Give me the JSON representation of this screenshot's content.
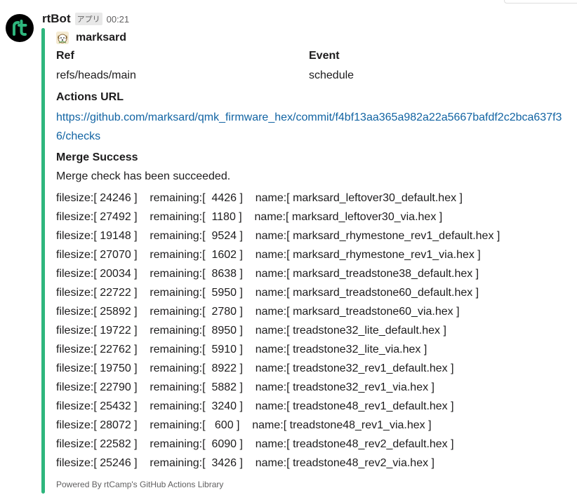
{
  "message": {
    "bot_name": "rtBot",
    "app_badge": "アプリ",
    "timestamp": "00:21",
    "avatar_icon": "rt-logo-icon"
  },
  "attachment": {
    "bar_color": "#2eb67d",
    "author": "marksard",
    "author_icon": "dog-avatar-icon",
    "fields": {
      "ref_title": "Ref",
      "ref_value": "refs/heads/main",
      "event_title": "Event",
      "event_value": "schedule",
      "actions_title": "Actions URL",
      "actions_url": "https://github.com/marksard/qmk_firmware_hex/commit/f4bf13aa365a982a22a5667bafdf2c2bca637f36/checks",
      "merge_title": "Merge Success",
      "merge_message": "Merge check has been succeeded."
    },
    "rows": [
      "filesize:[ 24246 ]    remaining:[  4426 ]    name:[ marksard_leftover30_default.hex ]",
      "filesize:[ 27492 ]    remaining:[  1180 ]    name:[ marksard_leftover30_via.hex ]",
      "filesize:[ 19148 ]    remaining:[  9524 ]    name:[ marksard_rhymestone_rev1_default.hex ]",
      "filesize:[ 27070 ]    remaining:[  1602 ]    name:[ marksard_rhymestone_rev1_via.hex ]",
      "filesize:[ 20034 ]    remaining:[  8638 ]    name:[ marksard_treadstone38_default.hex ]",
      "filesize:[ 22722 ]    remaining:[  5950 ]    name:[ marksard_treadstone60_default.hex ]",
      "filesize:[ 25892 ]    remaining:[  2780 ]    name:[ marksard_treadstone60_via.hex ]",
      "filesize:[ 19722 ]    remaining:[  8950 ]    name:[ treadstone32_lite_default.hex ]",
      "filesize:[ 22762 ]    remaining:[  5910 ]    name:[ treadstone32_lite_via.hex ]",
      "filesize:[ 19750 ]    remaining:[  8922 ]    name:[ treadstone32_rev1_default.hex ]",
      "filesize:[ 22790 ]    remaining:[  5882 ]    name:[ treadstone32_rev1_via.hex ]",
      "filesize:[ 25432 ]    remaining:[  3240 ]    name:[ treadstone48_rev1_default.hex ]",
      "filesize:[ 28072 ]    remaining:[   600 ]    name:[ treadstone48_rev1_via.hex ]",
      "filesize:[ 22582 ]    remaining:[  6090 ]    name:[ treadstone48_rev2_default.hex ]",
      "filesize:[ 25246 ]    remaining:[  3426 ]    name:[ treadstone48_rev2_via.hex ]"
    ],
    "footer": "Powered By rtCamp's GitHub Actions Library"
  }
}
